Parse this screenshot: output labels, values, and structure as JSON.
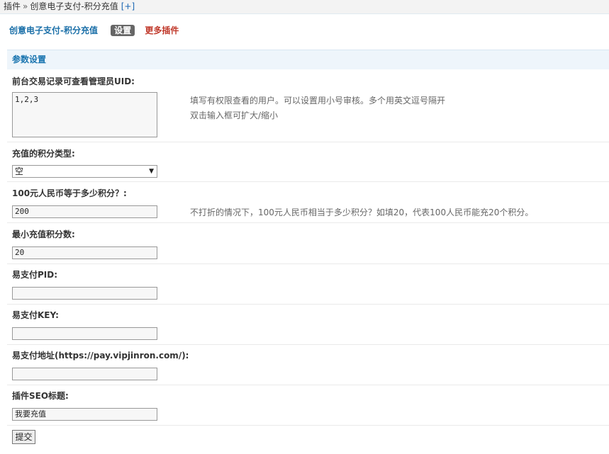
{
  "breadcrumb": {
    "root": "插件",
    "separator": "»",
    "current": "创意电子支付-积分充值",
    "add": "[+]"
  },
  "toolbar": {
    "plugin_name": "创意电子支付-积分充值",
    "settings": "设置",
    "more_plugins": "更多插件"
  },
  "section": {
    "title": "参数设置"
  },
  "fields": {
    "admin_uid": {
      "label": "前台交易记录可查看管理员UID:",
      "value": "1,2,3",
      "tip_line1": "填写有权限查看的用户。可以设置用小号审核。多个用英文逗号隔开",
      "tip_line2": "双击输入框可扩大/缩小"
    },
    "credit_type": {
      "label": "充值的积分类型:",
      "value": "空"
    },
    "rate": {
      "label": "100元人民币等于多少积分？:",
      "value": "200",
      "tip": "不打折的情况下，100元人民币相当于多少积分？如填20，代表100人民币能充20个积分。"
    },
    "min_credit": {
      "label": "最小充值积分数:",
      "value": "20"
    },
    "pid": {
      "label": "易支付PID:",
      "value": ""
    },
    "key": {
      "label": "易支付KEY:",
      "value": ""
    },
    "url": {
      "label": "易支付地址(https://pay.vipjinron.com/):",
      "value": ""
    },
    "seo_title": {
      "label": "插件SEO标题:",
      "value": "我要充值"
    }
  },
  "submit": {
    "label": "提交"
  }
}
